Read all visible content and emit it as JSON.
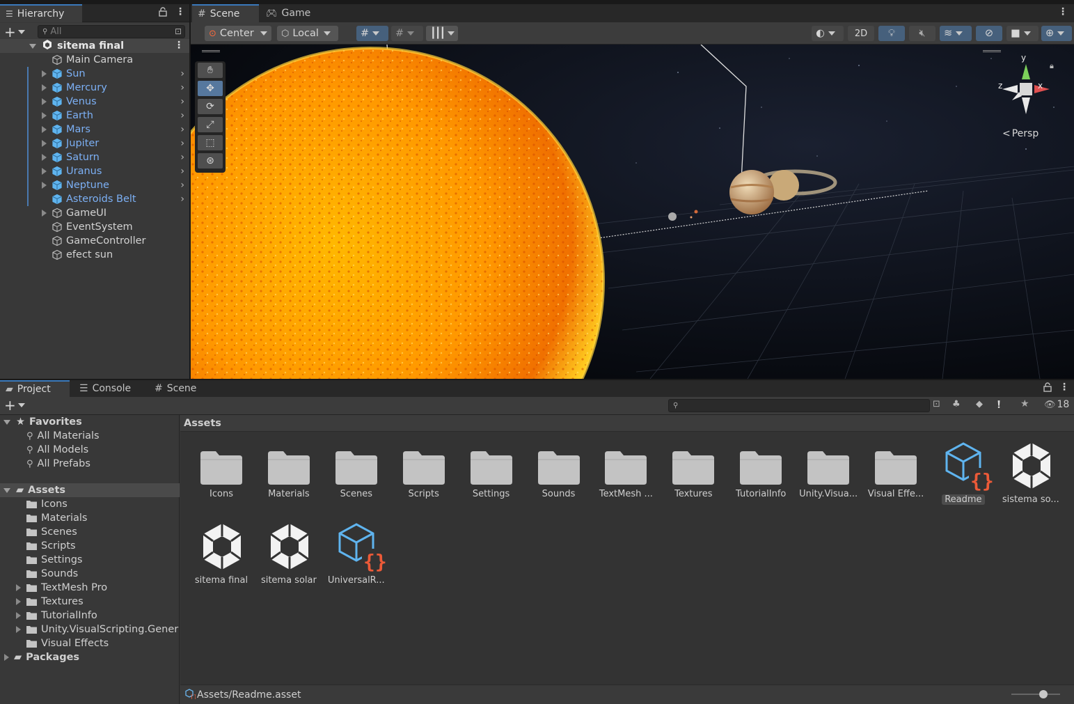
{
  "hierarchy": {
    "tab_label": "Hierarchy",
    "search_placeholder": "All",
    "scene_name": "sitema final",
    "items": [
      {
        "label": "Main Camera",
        "prefab": false,
        "expandable": false
      },
      {
        "label": "Sun",
        "prefab": true,
        "expandable": true
      },
      {
        "label": "Mercury",
        "prefab": true,
        "expandable": true
      },
      {
        "label": "Venus",
        "prefab": true,
        "expandable": true
      },
      {
        "label": "Earth",
        "prefab": true,
        "expandable": true
      },
      {
        "label": "Mars",
        "prefab": true,
        "expandable": true
      },
      {
        "label": "Jupiter",
        "prefab": true,
        "expandable": true
      },
      {
        "label": "Saturn",
        "prefab": true,
        "expandable": true
      },
      {
        "label": "Uranus",
        "prefab": true,
        "expandable": true
      },
      {
        "label": "Neptune",
        "prefab": true,
        "expandable": true
      },
      {
        "label": "Asteroids Belt",
        "prefab": true,
        "expandable": false
      },
      {
        "label": "GameUI",
        "prefab": false,
        "expandable": true
      },
      {
        "label": "EventSystem",
        "prefab": false,
        "expandable": false
      },
      {
        "label": "GameController",
        "prefab": false,
        "expandable": false
      },
      {
        "label": "efect sun",
        "prefab": false,
        "expandable": false
      }
    ]
  },
  "scene_view": {
    "tabs": [
      {
        "label": "Scene",
        "icon": "grid-icon"
      },
      {
        "label": "Game",
        "icon": "gamepad-icon"
      }
    ],
    "pivot_mode": "Center",
    "pivot_rotation": "Local",
    "toggle_2d": "2D",
    "projection_label": "Persp",
    "gizmo_axes": {
      "y": "y",
      "x": "x",
      "z": "z"
    }
  },
  "project": {
    "tabs": [
      {
        "label": "Project",
        "icon": "folder-icon"
      },
      {
        "label": "Console",
        "icon": "console-icon"
      },
      {
        "label": "Scene",
        "icon": "grid-icon"
      }
    ],
    "hidden_count": "18",
    "favorites": {
      "label": "Favorites",
      "items": [
        "All Materials",
        "All Models",
        "All Prefabs"
      ]
    },
    "assets_root": "Assets",
    "asset_folders": [
      {
        "label": "Icons",
        "expandable": false
      },
      {
        "label": "Materials",
        "expandable": false
      },
      {
        "label": "Scenes",
        "expandable": false
      },
      {
        "label": "Scripts",
        "expandable": false
      },
      {
        "label": "Settings",
        "expandable": false
      },
      {
        "label": "Sounds",
        "expandable": false
      },
      {
        "label": "TextMesh Pro",
        "expandable": true
      },
      {
        "label": "Textures",
        "expandable": true
      },
      {
        "label": "TutorialInfo",
        "expandable": true
      },
      {
        "label": "Unity.VisualScripting.Gener",
        "expandable": true
      },
      {
        "label": "Visual Effects",
        "expandable": false
      }
    ],
    "packages_label": "Packages",
    "path_label": "Assets",
    "grid_items": [
      {
        "label": "Icons",
        "kind": "folder"
      },
      {
        "label": "Materials",
        "kind": "folder"
      },
      {
        "label": "Scenes",
        "kind": "folder"
      },
      {
        "label": "Scripts",
        "kind": "folder"
      },
      {
        "label": "Settings",
        "kind": "folder"
      },
      {
        "label": "Sounds",
        "kind": "folder"
      },
      {
        "label": "TextMesh ...",
        "kind": "folder"
      },
      {
        "label": "Textures",
        "kind": "folder"
      },
      {
        "label": "TutorialInfo",
        "kind": "folder"
      },
      {
        "label": "Unity.Visua...",
        "kind": "folder"
      },
      {
        "label": "Visual Effe...",
        "kind": "folder"
      },
      {
        "label": "Readme",
        "kind": "script-asset",
        "selected": true
      },
      {
        "label": "sistema so...",
        "kind": "unity-scene"
      },
      {
        "label": "sitema final",
        "kind": "unity-scene"
      },
      {
        "label": "sitema solar",
        "kind": "unity-scene"
      },
      {
        "label": "UniversalR...",
        "kind": "script-asset"
      }
    ],
    "status_path": "Assets/Readme.asset",
    "zoom_slider_level": 0.65
  },
  "colors": {
    "accent": "#3a79bb",
    "prefab_text": "#7cb0f5",
    "panel_bg": "#383838",
    "sun_core": "#ffb000",
    "sun_edge": "#e85a00"
  }
}
